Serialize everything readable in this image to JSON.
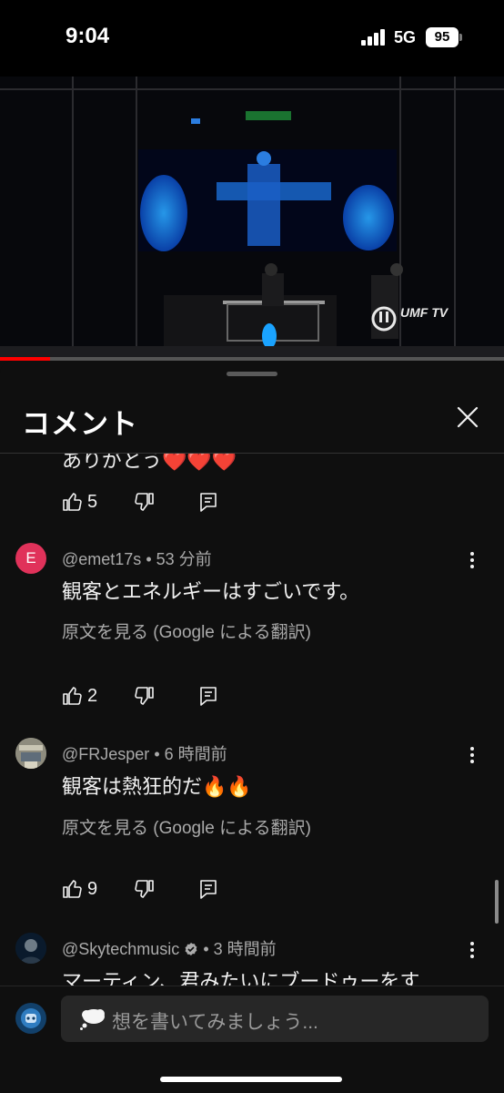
{
  "status_bar": {
    "time": "9:04",
    "network": "5G",
    "battery": "95"
  },
  "video": {
    "logo_text": "UMF TV",
    "progress_percent": 10
  },
  "panel": {
    "title": "コメント"
  },
  "comments": [
    {
      "text": "ありがとう❤️❤️❤️",
      "likes": "5"
    },
    {
      "avatar_letter": "E",
      "author": "@emet17s",
      "time": "53 分前",
      "separator": "•",
      "text": "観客とエネルギーはすごいです。",
      "translate_label": "原文を見る (Google による翻訳)",
      "likes": "2"
    },
    {
      "author": "@FRJesper",
      "time": "6 時間前",
      "separator": "•",
      "text": "観客は熱狂的だ🔥🔥",
      "translate_label": "原文を見る (Google による翻訳)",
      "likes": "9"
    },
    {
      "author": "@Skytechmusic",
      "time": "3 時間前",
      "separator": "•",
      "verified": true,
      "text": "マーティン、君みたいにブードゥーをす"
    }
  ],
  "composer": {
    "placeholder": "想を書いてみましょう..."
  },
  "colors": {
    "background": "#0f0f0f",
    "accent": "#ff0000",
    "avatar_e": "#e0325a"
  }
}
